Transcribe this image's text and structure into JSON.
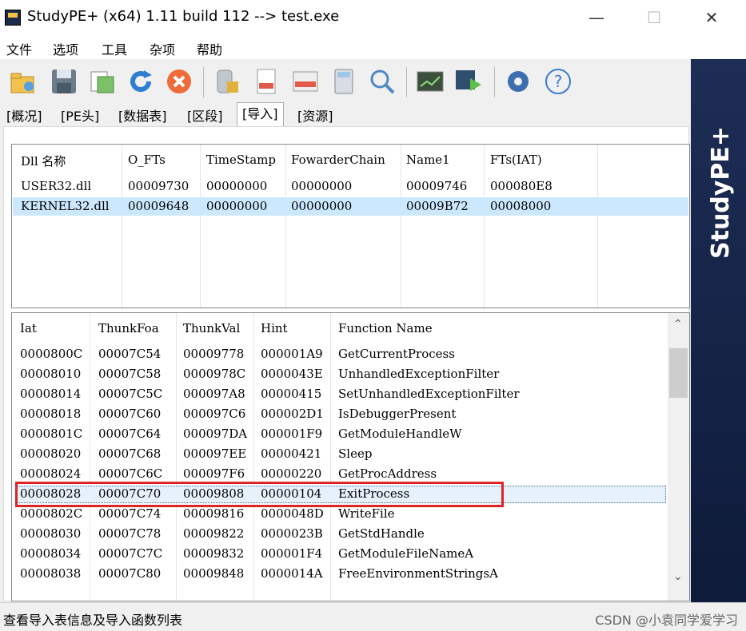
{
  "window": {
    "title": "StudyPE+ (x64) 1.11 build 112  --> test.exe"
  },
  "menu": [
    "文件",
    "选项",
    "工具",
    "杂项",
    "帮助"
  ],
  "toolbar_icons": [
    "open-icon",
    "save-icon",
    "copy-icon",
    "refresh-icon",
    "close-icon",
    "database-icon",
    "asm-file-icon",
    "asm-window-icon",
    "calculator-icon",
    "search-icon",
    "terminal-icon",
    "transfer-icon",
    "settings-icon",
    "help-icon"
  ],
  "tabs": [
    "[概况]",
    "[PE头]",
    "[数据表]",
    "[区段]",
    "[导入]",
    "[资源]"
  ],
  "active_tab": "[导入]",
  "sidebar_title": "StudyPE+",
  "dll_table": {
    "columns": [
      "Dll 名称",
      "O_FTs",
      "TimeStamp",
      "FowarderChain",
      "Name1",
      "FTs(IAT)"
    ],
    "rows": [
      [
        "USER32.dll",
        "00009730",
        "00000000",
        "00000000",
        "00009746",
        "000080E8"
      ],
      [
        "KERNEL32.dll",
        "00009648",
        "00000000",
        "00000000",
        "00009B72",
        "00008000"
      ]
    ],
    "selected_row": 1
  },
  "func_table": {
    "columns": [
      "Iat",
      "ThunkFoa",
      "ThunkVal",
      "Hint",
      "Function Name"
    ],
    "rows": [
      [
        "0000800C",
        "00007C54",
        "00009778",
        "000001A9",
        "GetCurrentProcess"
      ],
      [
        "00008010",
        "00007C58",
        "0000978C",
        "0000043E",
        "UnhandledExceptionFilter"
      ],
      [
        "00008014",
        "00007C5C",
        "000097A8",
        "00000415",
        "SetUnhandledExceptionFilter"
      ],
      [
        "00008018",
        "00007C60",
        "000097C6",
        "000002D1",
        "IsDebuggerPresent"
      ],
      [
        "0000801C",
        "00007C64",
        "000097DA",
        "000001F9",
        "GetModuleHandleW"
      ],
      [
        "00008020",
        "00007C68",
        "000097EE",
        "00000421",
        "Sleep"
      ],
      [
        "00008024",
        "00007C6C",
        "000097F6",
        "00000220",
        "GetProcAddress"
      ],
      [
        "00008028",
        "00007C70",
        "00009808",
        "00000104",
        "ExitProcess"
      ],
      [
        "0000802C",
        "00007C74",
        "00009816",
        "0000048D",
        "WriteFile"
      ],
      [
        "00008030",
        "00007C78",
        "00009822",
        "0000023B",
        "GetStdHandle"
      ],
      [
        "00008034",
        "00007C7C",
        "00009832",
        "000001F4",
        "GetModuleFileNameA"
      ],
      [
        "00008038",
        "00007C80",
        "00009848",
        "0000014A",
        "FreeEnvironmentStringsA"
      ]
    ],
    "selected_row": 7
  },
  "status": {
    "text": "查看导入表信息及导入函数列表",
    "watermark": "CSDN @小袁同学爱学习"
  }
}
